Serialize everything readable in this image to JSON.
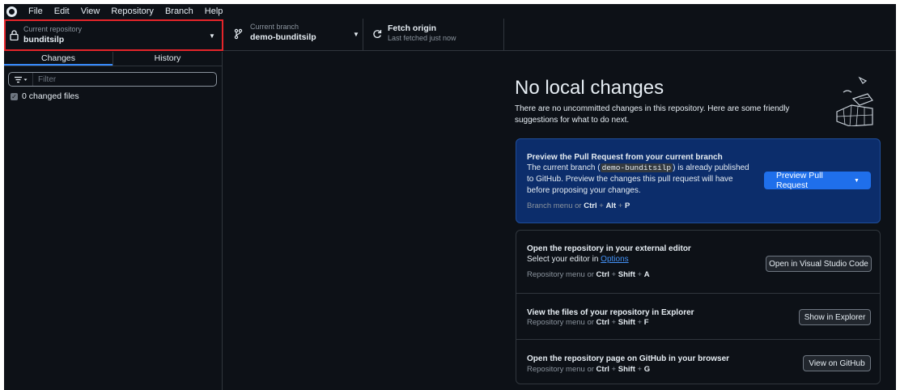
{
  "menu": [
    "File",
    "Edit",
    "View",
    "Repository",
    "Branch",
    "Help"
  ],
  "toolbar": {
    "repo_label": "Current repository",
    "repo_value": "bunditsilp",
    "branch_label": "Current branch",
    "branch_value": "demo-bunditsilp",
    "fetch_title": "Fetch origin",
    "fetch_sub": "Last fetched just now"
  },
  "sidebar": {
    "tabs": [
      "Changes",
      "History"
    ],
    "filter_placeholder": "Filter",
    "changed_files": "0 changed files"
  },
  "main": {
    "headline": "No local changes",
    "subline": "There are no uncommitted changes in this repository. Here are some friendly suggestions for what to do next.",
    "pr_card": {
      "title": "Preview the Pull Request from your current branch",
      "text_a": "The current branch (",
      "branch_code": "demo-bunditsilp",
      "text_b": ") is already published to GitHub. Preview the changes this pull request will have before proposing your changes.",
      "hint_prefix": "Branch menu or",
      "keys": [
        "Ctrl",
        "Alt",
        "P"
      ],
      "button": "Preview Pull Request"
    },
    "editor_card": {
      "title": "Open the repository in your external editor",
      "text_prefix": "Select your editor in",
      "text_link": "Options",
      "hint_prefix": "Repository menu or",
      "keys": [
        "Ctrl",
        "Shift",
        "A"
      ],
      "button": "Open in Visual Studio Code"
    },
    "explorer_card": {
      "title": "View the files of your repository in Explorer",
      "hint_prefix": "Repository menu or",
      "keys": [
        "Ctrl",
        "Shift",
        "F"
      ],
      "button": "Show in Explorer"
    },
    "github_card": {
      "title": "Open the repository page on GitHub in your browser",
      "hint_prefix": "Repository menu or",
      "keys": [
        "Ctrl",
        "Shift",
        "G"
      ],
      "button": "View on GitHub"
    }
  },
  "colors": {
    "background": "#0d1117",
    "accent_blue": "#1f6feb",
    "highlight_red": "#e5252a",
    "pr_card_bg": "#0c2d6b"
  },
  "icons": [
    "github-logo-icon",
    "lock-icon",
    "branch-icon",
    "refresh-icon",
    "chevron-down-icon",
    "filter-icon",
    "checkbox-icon"
  ]
}
